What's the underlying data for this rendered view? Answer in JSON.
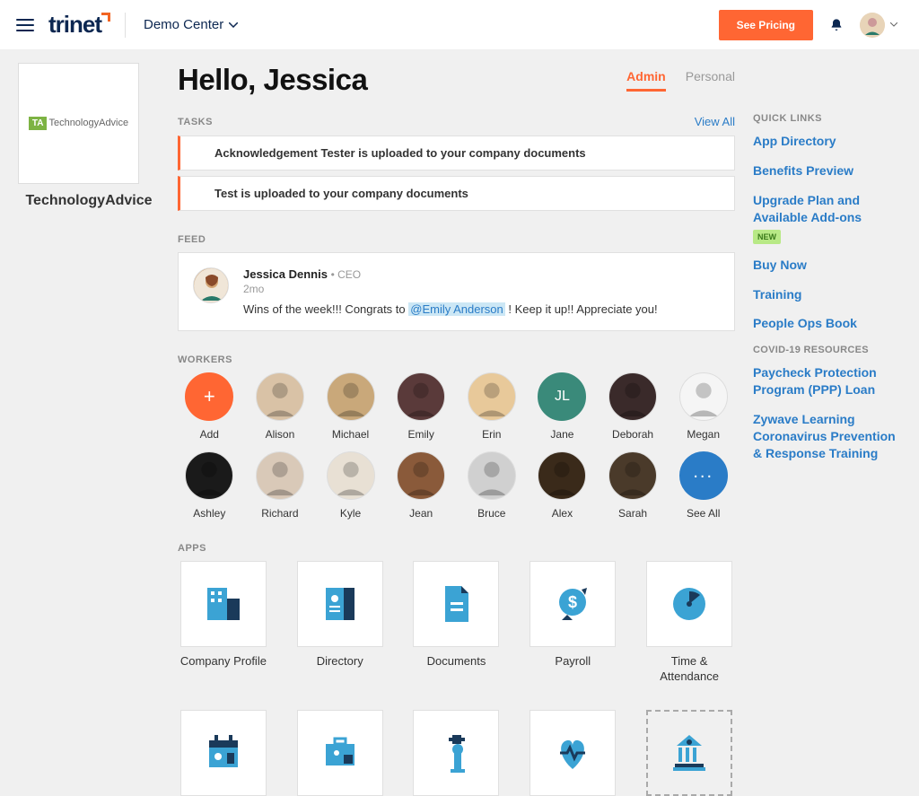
{
  "header": {
    "logo_text": "trinet",
    "demo_center": "Demo Center",
    "pricing_btn": "See Pricing"
  },
  "company": {
    "logo_prefix": "TA",
    "logo_text": "TechnologyAdvice",
    "name": "TechnologyAdvice"
  },
  "greeting": "Hello, Jessica",
  "tabs": {
    "admin": "Admin",
    "personal": "Personal"
  },
  "tasks": {
    "label": "TASKS",
    "view_all": "View All",
    "items": [
      "Acknowledgement Tester is uploaded to your company documents",
      "Test is uploaded to your company documents"
    ]
  },
  "feed": {
    "label": "FEED",
    "name": "Jessica Dennis",
    "role": "CEO",
    "time": "2mo",
    "text_before": "Wins of the week!!! Congrats to ",
    "mention": "@Emily Anderson",
    "text_after": " ! Keep it up!! Appreciate you!"
  },
  "workers": {
    "label": "WORKERS",
    "add": "Add",
    "list": [
      {
        "name": "Alison",
        "bg": "#d9c2a6"
      },
      {
        "name": "Michael",
        "bg": "#c9a87a"
      },
      {
        "name": "Emily",
        "bg": "#5a3a3a"
      },
      {
        "name": "Erin",
        "bg": "#e8c99a"
      },
      {
        "name": "Jane",
        "initials": "JL"
      },
      {
        "name": "Deborah",
        "bg": "#3a2a2a"
      },
      {
        "name": "Megan",
        "bg": "#f5f5f5"
      },
      {
        "name": "Ashley",
        "bg": "#1a1a1a"
      },
      {
        "name": "Richard",
        "bg": "#d9c9b8"
      },
      {
        "name": "Kyle",
        "bg": "#e8e0d4"
      },
      {
        "name": "Jean",
        "bg": "#8a5a3a"
      },
      {
        "name": "Bruce",
        "bg": "#d0d0d0"
      },
      {
        "name": "Alex",
        "bg": "#3a2a1a"
      },
      {
        "name": "Sarah",
        "bg": "#4a3a2a"
      }
    ],
    "see_all": "See All"
  },
  "apps": {
    "label": "APPS",
    "row1": [
      {
        "name": "Company Profile",
        "icon": "company"
      },
      {
        "name": "Directory",
        "icon": "directory"
      },
      {
        "name": "Documents",
        "icon": "documents"
      },
      {
        "name": "Payroll",
        "icon": "payroll"
      },
      {
        "name": "Time & Attendance",
        "icon": "time"
      }
    ],
    "row2": [
      {
        "icon": "calendar"
      },
      {
        "icon": "briefcase"
      },
      {
        "icon": "medical"
      },
      {
        "icon": "heart"
      },
      {
        "icon": "gov",
        "dashed": true
      }
    ]
  },
  "quick_links": {
    "label": "QUICK LINKS",
    "items": [
      {
        "text": "App Directory"
      },
      {
        "text": "Benefits Preview"
      },
      {
        "text": "Upgrade Plan and Available Add-ons",
        "badge": "NEW"
      },
      {
        "text": "Buy Now"
      },
      {
        "text": "Training"
      },
      {
        "text": "People Ops Book"
      }
    ],
    "resources_label": "COVID-19 RESOURCES",
    "resources": [
      {
        "text": "Paycheck Protection Program (PPP) Loan"
      },
      {
        "text": "Zywave Learning Coronavirus Prevention & Response Training"
      }
    ]
  }
}
